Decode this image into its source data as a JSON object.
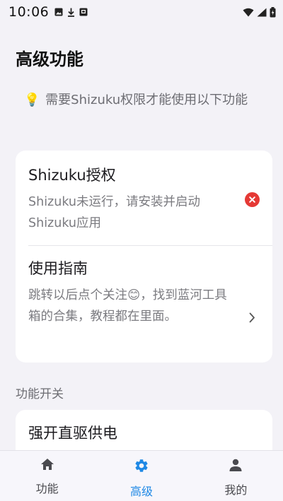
{
  "status_bar": {
    "time": "10:06",
    "left_icons": [
      "image-icon",
      "download-icon",
      "notification-icon"
    ],
    "right_icons": [
      "wifi-icon",
      "signal-icon",
      "battery-icon"
    ]
  },
  "page": {
    "title": "高级功能",
    "notice": "需要Shizuku权限才能使用以下功能",
    "notice_icon": "💡"
  },
  "card_main": {
    "shizuku": {
      "title": "Shizuku授权",
      "desc": "Shizuku未运行，请安装并启动Shizuku应用",
      "status_icon": "error-icon"
    },
    "guide": {
      "title": "使用指南",
      "desc": "跳转以后点个关注😊，找到蓝河工具箱的合集，教程都在里面。",
      "action_icon": "chevron-right-icon"
    }
  },
  "section": {
    "label": "功能开关"
  },
  "card_switch": {
    "item1": {
      "title": "强开直驱供电"
    }
  },
  "bottom_nav": {
    "items": [
      {
        "label": "功能",
        "icon": "home-icon",
        "active": false
      },
      {
        "label": "高级",
        "icon": "gear-icon",
        "active": true
      },
      {
        "label": "我的",
        "icon": "person-icon",
        "active": false
      }
    ]
  },
  "colors": {
    "accent": "#1e88e5",
    "error": "#e53935",
    "background": "#f3f2f7"
  }
}
